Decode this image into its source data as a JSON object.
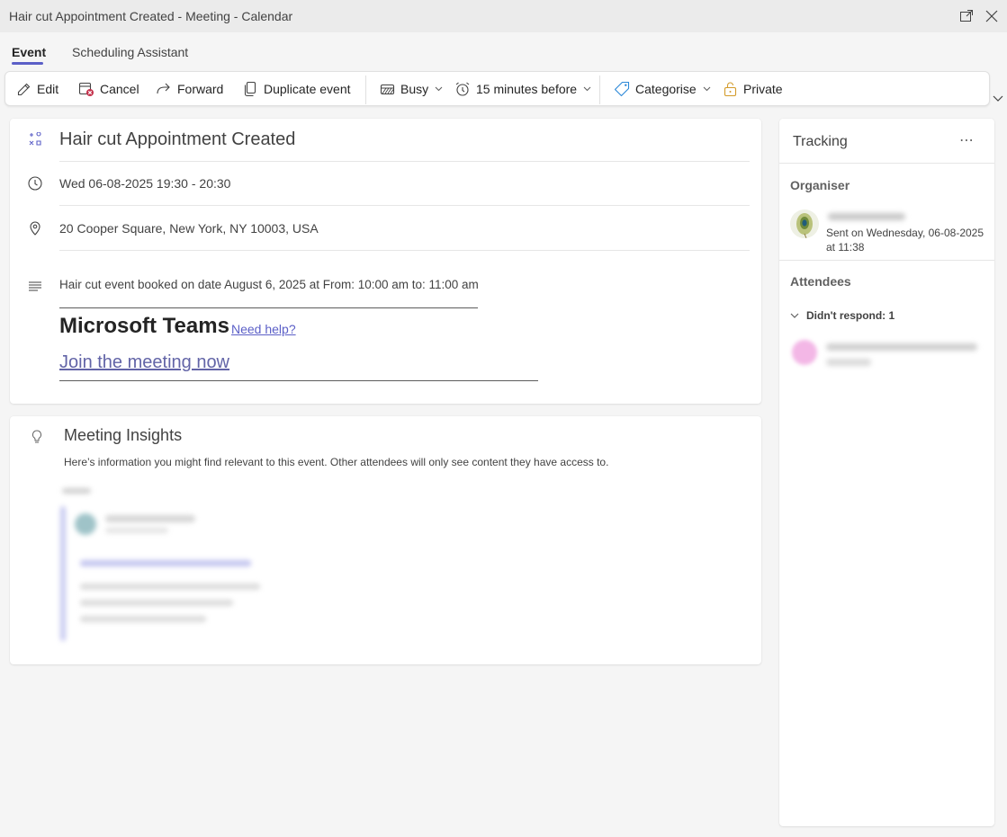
{
  "window": {
    "title": "Hair cut Appointment Created - Meeting - Calendar"
  },
  "tabs": [
    {
      "label": "Event",
      "active": true
    },
    {
      "label": "Scheduling Assistant",
      "active": false
    }
  ],
  "toolbar": {
    "edit": "Edit",
    "cancel": "Cancel",
    "forward": "Forward",
    "duplicate": "Duplicate event",
    "busy": "Busy",
    "reminder": "15 minutes before",
    "categorise": "Categorise",
    "private": "Private"
  },
  "event": {
    "subject": "Hair cut Appointment Created",
    "datetime": "Wed 06-08-2025 19:30 - 20:30",
    "location": "20 Cooper Square, New York, NY 10003, USA",
    "body": "Hair cut event booked on date August 6, 2025 at From: 10:00 am to: 11:00 am",
    "teams_title": "Microsoft Teams",
    "need_help": "Need help?",
    "join_link": "Join the meeting now"
  },
  "insights": {
    "title": "Meeting Insights",
    "description": "Here’s information you might find relevant to this event. Other attendees will only see content they have access to."
  },
  "tracking": {
    "title": "Tracking",
    "more": "⋯",
    "organiser_label": "Organiser",
    "sent": "Sent on Wednesday, 06-08-2025 at 11:38",
    "attendees_label": "Attendees",
    "didnt_respond": "Didn't respond: 1"
  },
  "colors": {
    "accent": "#5b5fc7",
    "link": "#6264a7",
    "cancel_red": "#c4314b",
    "private_amber": "#d39b2a"
  }
}
